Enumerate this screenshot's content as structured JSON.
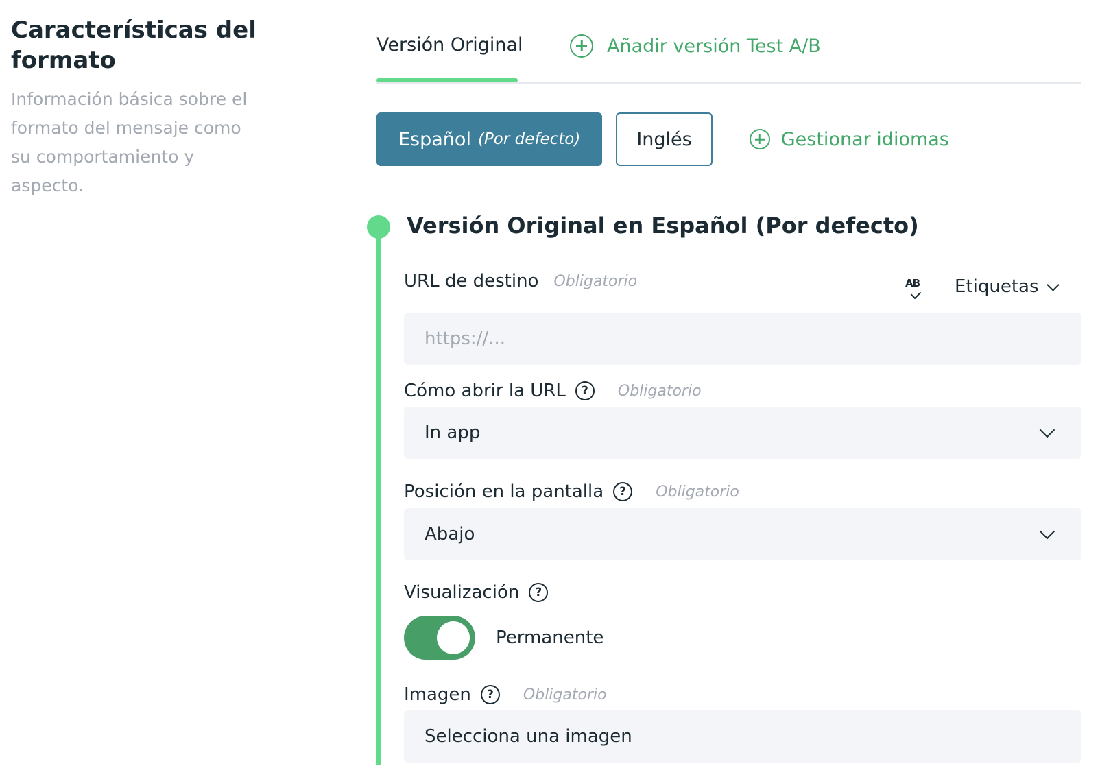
{
  "sidebar": {
    "title": "Características del formato",
    "description": "Información básica sobre el formato del mensaje como su comportamiento y aspecto."
  },
  "tabs": {
    "original": "Versión Original",
    "add_ab": "Añadir versión Test A/B"
  },
  "languages": {
    "primary": "Español",
    "primary_note": "(Por defecto)",
    "secondary": "Inglés",
    "manage": "Gestionar idiomas"
  },
  "version": {
    "title": "Versión Original en Español (Por defecto)"
  },
  "fields": {
    "url": {
      "label": "URL de destino",
      "required": "Obligatorio",
      "value": "",
      "placeholder": "https://..."
    },
    "labels_menu": "Etiquetas",
    "ab_icon_text": "AB",
    "open_url": {
      "label": "Cómo abrir la URL",
      "required": "Obligatorio",
      "value": "In app"
    },
    "position": {
      "label": "Posición en la pantalla",
      "required": "Obligatorio",
      "value": "Abajo"
    },
    "display": {
      "label": "Visualización",
      "toggle_label": "Permanente",
      "toggle_on": true
    },
    "image": {
      "label": "Imagen",
      "required": "Obligatorio",
      "value": "Selecciona una imagen"
    }
  },
  "help_icon_glyph": "?",
  "colors": {
    "accent_green": "#63d98c",
    "link_green": "#43a86a",
    "primary_blue": "#3d7f9a",
    "toggle_green": "#479e67",
    "field_bg": "#f3f5f8",
    "muted_text": "#a3a9b2"
  }
}
